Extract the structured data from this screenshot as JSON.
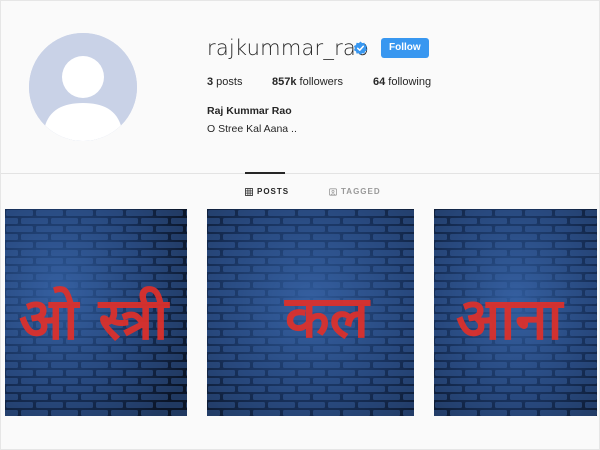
{
  "profile": {
    "username": "rajkummar_rao",
    "verified": true,
    "follow_label": "Follow",
    "full_name": "Raj Kummar Rao",
    "bio": "O Stree Kal Aana .."
  },
  "stats": {
    "posts_count": "3",
    "posts_label": " posts",
    "followers_count": "857k",
    "followers_label": " followers",
    "following_count": "64",
    "following_label": " following"
  },
  "tabs": [
    {
      "label": "POSTS",
      "icon": "grid-icon",
      "active": true
    },
    {
      "label": "TAGGED",
      "icon": "tag-icon",
      "active": false
    }
  ],
  "posts": [
    {
      "text": "ओ स्त्री"
    },
    {
      "text": "कल"
    },
    {
      "text": "आना"
    }
  ],
  "colors": {
    "accent": "#3897f0",
    "poster_red": "#e0302a",
    "brick_blue": "#1e3a6b"
  }
}
